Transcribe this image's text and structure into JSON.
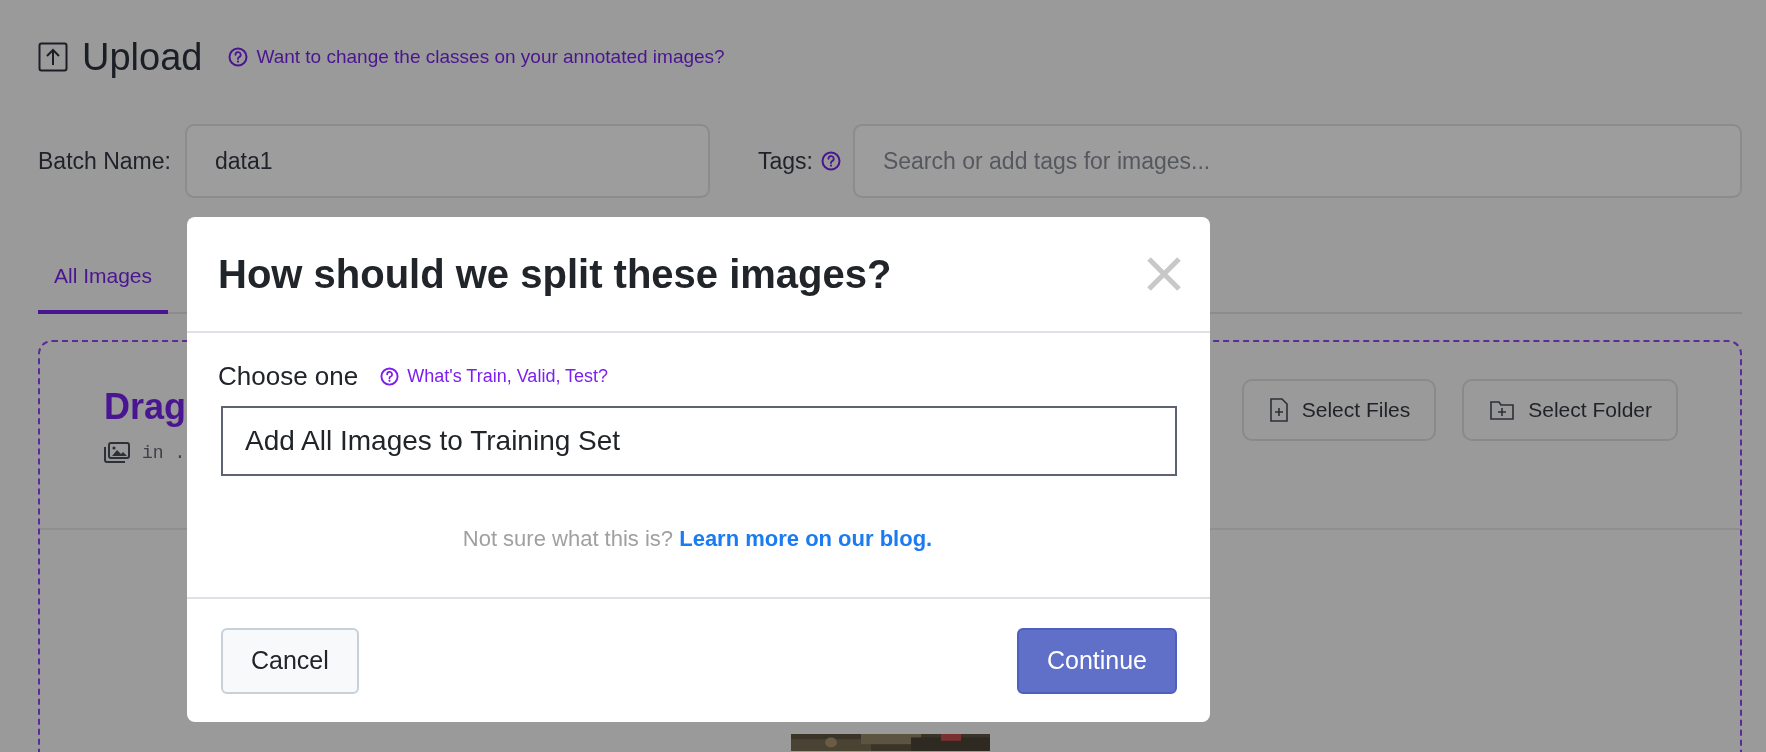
{
  "page": {
    "title": "Upload",
    "help_link": "Want to change the classes on your annotated images?",
    "batch_name": {
      "label": "Batch Name:",
      "value": "data1"
    },
    "tags": {
      "label": "Tags:",
      "placeholder": "Search or add tags for images..."
    },
    "tabs": [
      {
        "label": "All Images",
        "selected": true
      }
    ],
    "dropzone": {
      "heading": "Drag",
      "subtext": "in .",
      "buttons": [
        "Select Files",
        "Select Folder"
      ]
    }
  },
  "dialog": {
    "title": "How should we split these images?",
    "field_label": "Choose one",
    "help_link": "What's Train, Valid, Test?",
    "select_value": "Add All Images to Training Set",
    "note": "Not sure what this is?",
    "note_link": "Learn more on our blog.",
    "buttons": [
      {
        "label": "Cancel",
        "kind": "secondary"
      },
      {
        "label": "Continue",
        "kind": "primary"
      }
    ]
  }
}
